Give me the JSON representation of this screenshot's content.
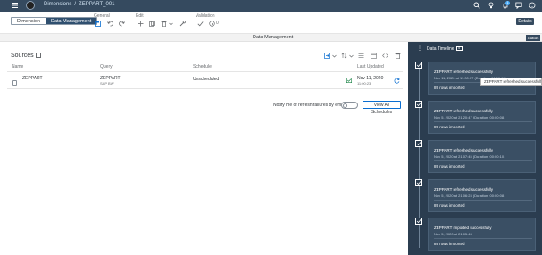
{
  "shell": {
    "breadcrumb_root": "Dimensions",
    "breadcrumb_sep": "/",
    "breadcrumb_current": "ZEPPART_001",
    "notification_count": "1"
  },
  "toolbar": {
    "tab_dimension": "Dimension",
    "tab_data_management": "Data Management",
    "group_general": "General",
    "group_edit": "Edit",
    "group_validation": "Validation",
    "validation_count": "0",
    "details_label": "Details"
  },
  "page": {
    "title": "Data Management",
    "status_label": "Status"
  },
  "sources": {
    "title": "Sources",
    "columns": {
      "name": "Name",
      "query": "Query",
      "schedule": "Schedule",
      "last_updated": "Last Updated"
    },
    "rows": [
      {
        "name": "ZEPPART",
        "query": "ZEPPART",
        "query_sub": "SAP BW",
        "schedule": "Unscheduled",
        "last_updated_date": "Nov 11, 2020",
        "last_updated_time": "11:00:23"
      }
    ],
    "notify_label": "Notify me of refresh failures by email",
    "view_all_label": "View All Schedules"
  },
  "timeline": {
    "title": "Data Timeline",
    "count": "5",
    "items": [
      {
        "title": "ZEPPART refreshed successfully",
        "date": "Nov 11, 2020 at 11:00:07 (Duration: 00:00:15)",
        "rows": "89 rows imported"
      },
      {
        "title": "ZEPPART refreshed successfully",
        "date": "Nov 5, 2020 at 21:20:47 (Duration: 00:00:08)",
        "rows": "89 rows imported"
      },
      {
        "title": "ZEPPART refreshed successfully",
        "date": "Nov 5, 2020 at 21:07:45 (Duration: 00:00:10)",
        "rows": "89 rows imported"
      },
      {
        "title": "ZEPPART refreshed successfully",
        "date": "Nov 5, 2020 at 21:06:23 (Duration: 00:00:08)",
        "rows": "89 rows imported"
      },
      {
        "title": "ZEPPART imported successfully",
        "date": "Nov 5, 2020 at 21:05:43",
        "rows": "89 rows imported"
      }
    ],
    "tooltip": "ZEPPART refreshed successfully"
  },
  "colors": {
    "shell": "#354a5f",
    "panel": "#2b3d50",
    "accent": "#0a6ed1",
    "success": "#107e3e"
  }
}
